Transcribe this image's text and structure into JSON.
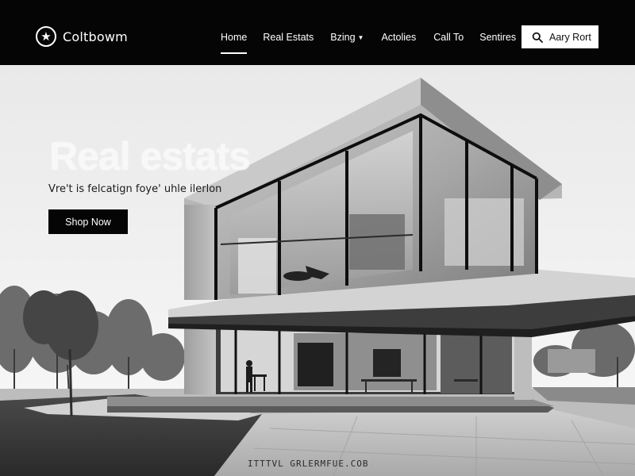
{
  "brand": {
    "name": "Coltbowm",
    "logo_icon": "star-icon"
  },
  "nav": {
    "items": [
      {
        "label": "Home",
        "active": true
      },
      {
        "label": "Real Estats",
        "active": false
      },
      {
        "label": "Bzing",
        "active": false,
        "has_dropdown": true
      },
      {
        "label": "Actolies",
        "active": false
      },
      {
        "label": "Call To",
        "active": false
      },
      {
        "label": "Sentires",
        "active": false
      }
    ]
  },
  "search": {
    "label": "Aary Rort",
    "icon": "search-icon"
  },
  "hero": {
    "title": "Real estats",
    "subtitle": "Vre't is felcatign foye' uhle ilerlon",
    "cta_label": "Shop Now",
    "watermark": "ITTTVL GRLERMFUE.COB"
  },
  "colors": {
    "header_bg": "#050505",
    "button_bg": "#050505",
    "text_light": "#ffffff"
  }
}
